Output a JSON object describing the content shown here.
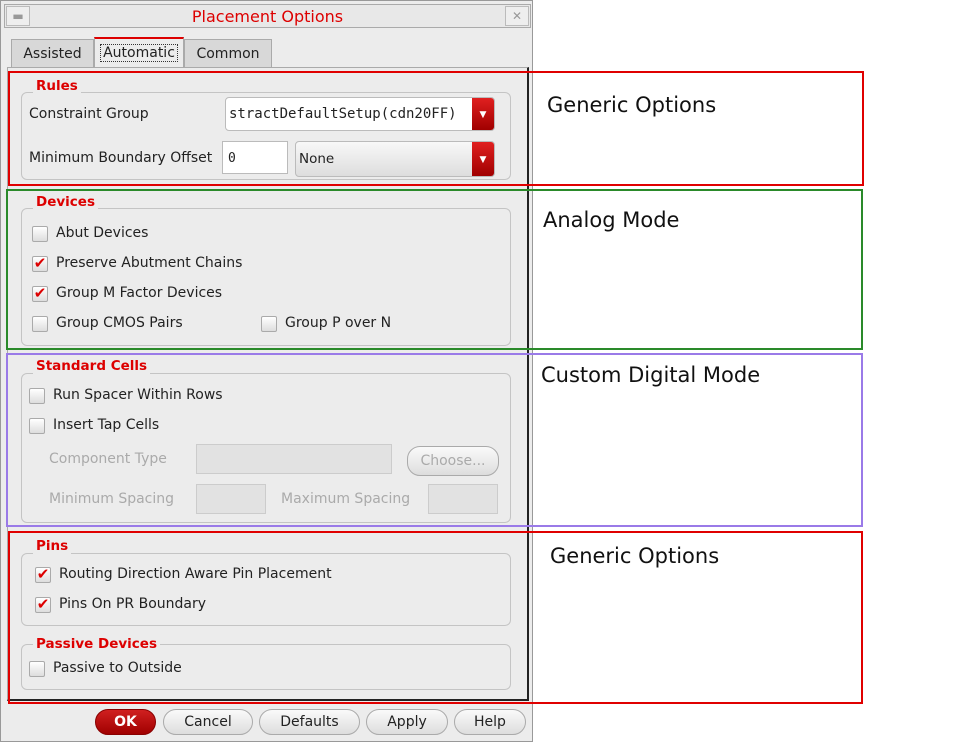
{
  "window": {
    "title": "Placement Options",
    "minimize_icon": "minimize-icon",
    "close_icon": "close-icon"
  },
  "tabs": [
    {
      "label": "Assisted"
    },
    {
      "label": "Automatic",
      "active": true
    },
    {
      "label": "Common"
    }
  ],
  "rules": {
    "title": "Rules",
    "constraint_group_label": "Constraint Group",
    "constraint_group_value": "stractDefaultSetup(cdn20FF)",
    "min_boundary_label": "Minimum Boundary Offset",
    "min_boundary_value": "0",
    "min_boundary_unit": "None"
  },
  "devices": {
    "title": "Devices",
    "items": [
      {
        "label": "Abut Devices",
        "checked": false
      },
      {
        "label": "Preserve Abutment Chains",
        "checked": true
      },
      {
        "label": "Group M Factor Devices",
        "checked": true
      },
      {
        "label": "Group CMOS Pairs",
        "checked": false
      },
      {
        "label": "Group P over N",
        "checked": false
      }
    ]
  },
  "standard_cells": {
    "title": "Standard Cells",
    "items": [
      {
        "label": "Run Spacer Within Rows",
        "checked": false
      },
      {
        "label": "Insert Tap Cells",
        "checked": false
      }
    ],
    "component_type_label": "Component Type",
    "choose_label": "Choose...",
    "min_spacing_label": "Minimum Spacing",
    "max_spacing_label": "Maximum Spacing"
  },
  "pins": {
    "title": "Pins",
    "items": [
      {
        "label": "Routing Direction Aware Pin Placement",
        "checked": true
      },
      {
        "label": "Pins On PR Boundary",
        "checked": true
      }
    ]
  },
  "passive": {
    "title": "Passive Devices",
    "items": [
      {
        "label": "Passive to Outside",
        "checked": false
      }
    ]
  },
  "buttons": {
    "ok": "OK",
    "cancel": "Cancel",
    "defaults": "Defaults",
    "apply": "Apply",
    "help": "Help"
  },
  "annotations": [
    {
      "label": "Generic Options",
      "color": "#e00000"
    },
    {
      "label": "Analog Mode",
      "color": "#2a8a2a"
    },
    {
      "label": "Custom Digital Mode",
      "color": "#9a7ae8"
    },
    {
      "label": "Generic Options",
      "color": "#e00000"
    }
  ]
}
